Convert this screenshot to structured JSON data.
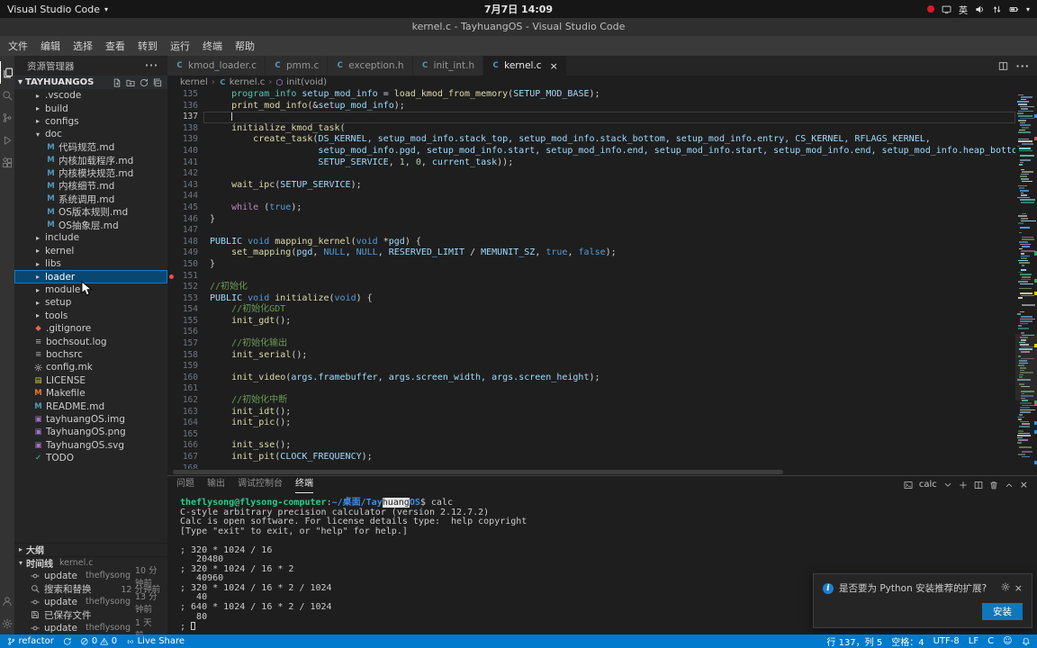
{
  "system_bar": {
    "app_name": "Visual Studio Code",
    "clock": "7月7日 14:09",
    "input_method": "英"
  },
  "title_bar": {
    "title": "kernel.c - TayhuangOS - Visual Studio Code"
  },
  "menu_bar": {
    "items": [
      "文件",
      "编辑",
      "选择",
      "查看",
      "转到",
      "运行",
      "终端",
      "帮助"
    ]
  },
  "activity_bar": {
    "top": [
      {
        "name": "explorer",
        "active": true
      },
      {
        "name": "search"
      },
      {
        "name": "source-control"
      },
      {
        "name": "run-debug"
      },
      {
        "name": "extensions"
      }
    ],
    "bottom": [
      {
        "name": "account"
      },
      {
        "name": "settings"
      }
    ]
  },
  "sidebar": {
    "header": "资源管理器",
    "project": "TAYHUANGOS",
    "tree": [
      {
        "label": ".vscode",
        "kind": "folder",
        "depth": 1
      },
      {
        "label": "build",
        "kind": "folder",
        "depth": 1
      },
      {
        "label": "configs",
        "kind": "folder",
        "depth": 1
      },
      {
        "label": "doc",
        "kind": "folder",
        "depth": 1,
        "expanded": true
      },
      {
        "label": "代码规范.md",
        "kind": "file",
        "icon": "markdown",
        "depth": 2
      },
      {
        "label": "内核加载程序.md",
        "kind": "file",
        "icon": "markdown",
        "depth": 2
      },
      {
        "label": "内核模块规范.md",
        "kind": "file",
        "icon": "markdown",
        "depth": 2
      },
      {
        "label": "内核细节.md",
        "kind": "file",
        "icon": "markdown",
        "depth": 2
      },
      {
        "label": "系统调用.md",
        "kind": "file",
        "icon": "markdown",
        "depth": 2
      },
      {
        "label": "OS版本规则.md",
        "kind": "file",
        "icon": "markdown",
        "depth": 2
      },
      {
        "label": "OS抽象层.md",
        "kind": "file",
        "icon": "markdown",
        "depth": 2
      },
      {
        "label": "include",
        "kind": "folder",
        "depth": 1
      },
      {
        "label": "kernel",
        "kind": "folder",
        "depth": 1
      },
      {
        "label": "libs",
        "kind": "folder",
        "depth": 1
      },
      {
        "label": "loader",
        "kind": "folder",
        "depth": 1,
        "selected": true
      },
      {
        "label": "module",
        "kind": "folder",
        "depth": 1
      },
      {
        "label": "setup",
        "kind": "folder",
        "depth": 1
      },
      {
        "label": "tools",
        "kind": "folder",
        "depth": 1
      },
      {
        "label": ".gitignore",
        "kind": "file",
        "icon": "git",
        "depth": 1
      },
      {
        "label": "bochsout.log",
        "kind": "file",
        "icon": "log",
        "depth": 1
      },
      {
        "label": "bochsrc",
        "kind": "file",
        "icon": "log",
        "depth": 1
      },
      {
        "label": "config.mk",
        "kind": "file",
        "icon": "config",
        "depth": 1
      },
      {
        "label": "LICENSE",
        "kind": "file",
        "icon": "license",
        "depth": 1
      },
      {
        "label": "Makefile",
        "kind": "file",
        "icon": "makefile",
        "depth": 1
      },
      {
        "label": "README.md",
        "kind": "file",
        "icon": "markdown",
        "depth": 1
      },
      {
        "label": "tayhuangOS.img",
        "kind": "file",
        "icon": "image",
        "depth": 1
      },
      {
        "label": "TayhuangOS.png",
        "kind": "file",
        "icon": "image",
        "depth": 1
      },
      {
        "label": "TayhuangOS.svg",
        "kind": "file",
        "icon": "image",
        "depth": 1
      },
      {
        "label": "TODO",
        "kind": "file",
        "icon": "todo",
        "depth": 1
      }
    ],
    "outline_label": "大纲",
    "timeline_label": "时间线",
    "timeline_file": "kernel.c",
    "timeline": [
      {
        "icon": "git-commit",
        "label": "update",
        "author": "theflysong",
        "time": "10 分钟前"
      },
      {
        "icon": "search",
        "label": "搜索和替换",
        "author": "",
        "time": "12 分钟前"
      },
      {
        "icon": "git-commit",
        "label": "update",
        "author": "theflysong",
        "time": "13 分钟前"
      },
      {
        "icon": "save",
        "label": "已保存文件",
        "author": "",
        "time": ""
      },
      {
        "icon": "git-commit",
        "label": "update",
        "author": "theflysong",
        "time": "1 天前"
      }
    ]
  },
  "editor": {
    "tabs": [
      {
        "label": "kmod_loader.c"
      },
      {
        "label": "pmm.c"
      },
      {
        "label": "exception.h"
      },
      {
        "label": "init_int.h"
      },
      {
        "label": "kernel.c",
        "active": true
      }
    ],
    "breadcrumb": [
      {
        "label": "kernel"
      },
      {
        "label": "kernel.c",
        "icon": "c-file"
      },
      {
        "label": "init(void)",
        "icon": "symbol-method"
      }
    ],
    "cursor": {
      "line": 137,
      "col": 5
    },
    "lines": [
      {
        "n": 135,
        "s": [
          [
            "    ",
            ""
          ],
          [
            "program_info",
            "t"
          ],
          [
            " ",
            ""
          ],
          [
            "setup_mod_info",
            "v"
          ],
          [
            " = ",
            ""
          ],
          [
            "load_kmod_from_memory",
            "f"
          ],
          [
            "(",
            ""
          ],
          [
            "SETUP_MOD_BASE",
            "v"
          ],
          [
            ");",
            ""
          ]
        ]
      },
      {
        "n": 136,
        "s": [
          [
            "    ",
            ""
          ],
          [
            "print_mod_info",
            "f"
          ],
          [
            "(&",
            ""
          ],
          [
            "setup_mod_info",
            "v"
          ],
          [
            ");",
            ""
          ]
        ]
      },
      {
        "n": 137,
        "s": [
          [
            "    ",
            ""
          ]
        ],
        "cur": true
      },
      {
        "n": 138,
        "s": [
          [
            "    ",
            ""
          ],
          [
            "initialize_kmod_task",
            "f"
          ],
          [
            "(",
            ""
          ]
        ]
      },
      {
        "n": 139,
        "s": [
          [
            "        ",
            ""
          ],
          [
            "create_task",
            "f"
          ],
          [
            "(",
            ""
          ],
          [
            "DS_KERNEL, setup_mod_info.stack_top, setup_mod_info.stack_bottom, setup_mod_info.entry, CS_KERNEL, RFLAGS_KERNEL,",
            "v"
          ]
        ]
      },
      {
        "n": 140,
        "s": [
          [
            "                    ",
            ""
          ],
          [
            "setup_mod_info.pgd, setup_mod_info.start, setup_mod_info.end, setup_mod_info.start, setup_mod_info.end, setup_mod_info.heap_bottom, setup_mod_info.heap_top,",
            "v"
          ]
        ]
      },
      {
        "n": 141,
        "s": [
          [
            "                    ",
            ""
          ],
          [
            "SETUP_SERVICE",
            "v"
          ],
          [
            ", ",
            ""
          ],
          [
            "1",
            "n"
          ],
          [
            ", ",
            ""
          ],
          [
            "0",
            "n"
          ],
          [
            ", ",
            ""
          ],
          [
            "current_task",
            "v"
          ],
          [
            "));",
            ""
          ]
        ]
      },
      {
        "n": 142,
        "s": []
      },
      {
        "n": 143,
        "s": [
          [
            "    ",
            ""
          ],
          [
            "wait_ipc",
            "f"
          ],
          [
            "(",
            ""
          ],
          [
            "SETUP_SERVICE",
            "v"
          ],
          [
            ");",
            ""
          ]
        ]
      },
      {
        "n": 144,
        "s": []
      },
      {
        "n": 145,
        "s": [
          [
            "    ",
            ""
          ],
          [
            "while",
            "kc"
          ],
          [
            " (",
            ""
          ],
          [
            "true",
            "k"
          ],
          [
            ");",
            ""
          ]
        ]
      },
      {
        "n": 146,
        "s": [
          [
            "}",
            ""
          ]
        ]
      },
      {
        "n": 147,
        "s": []
      },
      {
        "n": 148,
        "s": [
          [
            "PUBLIC",
            "v"
          ],
          [
            " ",
            ""
          ],
          [
            "void",
            "k"
          ],
          [
            " ",
            ""
          ],
          [
            "mapping_kernel",
            "f"
          ],
          [
            "(",
            ""
          ],
          [
            "void",
            "k"
          ],
          [
            " *",
            ""
          ],
          [
            "pgd",
            "v"
          ],
          [
            ") {",
            ""
          ]
        ]
      },
      {
        "n": 149,
        "s": [
          [
            "    ",
            ""
          ],
          [
            "set_mapping",
            "f"
          ],
          [
            "(",
            ""
          ],
          [
            "pgd",
            "v"
          ],
          [
            ", ",
            ""
          ],
          [
            "NULL",
            "k"
          ],
          [
            ", ",
            ""
          ],
          [
            "NULL",
            "k"
          ],
          [
            ", ",
            ""
          ],
          [
            "RESERVED_LIMIT",
            "v"
          ],
          [
            " / ",
            ""
          ],
          [
            "MEMUNIT_SZ",
            "v"
          ],
          [
            ", ",
            ""
          ],
          [
            "true",
            "k"
          ],
          [
            ", ",
            ""
          ],
          [
            "false",
            "k"
          ],
          [
            ");",
            ""
          ]
        ]
      },
      {
        "n": 150,
        "s": [
          [
            "}",
            ""
          ]
        ]
      },
      {
        "n": 151,
        "s": [],
        "gm": true
      },
      {
        "n": 152,
        "s": [
          [
            "//初始化",
            "c"
          ]
        ]
      },
      {
        "n": 153,
        "s": [
          [
            "PUBLIC",
            "v"
          ],
          [
            " ",
            ""
          ],
          [
            "void",
            "k"
          ],
          [
            " ",
            ""
          ],
          [
            "initialize",
            "f"
          ],
          [
            "(",
            ""
          ],
          [
            "void",
            "k"
          ],
          [
            ") {",
            ""
          ]
        ]
      },
      {
        "n": 154,
        "s": [
          [
            "    //初始化GDT",
            "c"
          ]
        ]
      },
      {
        "n": 155,
        "s": [
          [
            "    ",
            ""
          ],
          [
            "init_gdt",
            "f"
          ],
          [
            "();",
            ""
          ]
        ]
      },
      {
        "n": 156,
        "s": []
      },
      {
        "n": 157,
        "s": [
          [
            "    //初始化输出",
            "c"
          ]
        ]
      },
      {
        "n": 158,
        "s": [
          [
            "    ",
            ""
          ],
          [
            "init_serial",
            "f"
          ],
          [
            "();",
            ""
          ]
        ]
      },
      {
        "n": 159,
        "s": []
      },
      {
        "n": 160,
        "s": [
          [
            "    ",
            ""
          ],
          [
            "init_video",
            "f"
          ],
          [
            "(",
            ""
          ],
          [
            "args.framebuffer, args.screen_width, args.screen_height",
            "v"
          ],
          [
            ");",
            ""
          ]
        ]
      },
      {
        "n": 161,
        "s": []
      },
      {
        "n": 162,
        "s": [
          [
            "    //初始化中断",
            "c"
          ]
        ]
      },
      {
        "n": 163,
        "s": [
          [
            "    ",
            ""
          ],
          [
            "init_idt",
            "f"
          ],
          [
            "();",
            ""
          ]
        ]
      },
      {
        "n": 164,
        "s": [
          [
            "    ",
            ""
          ],
          [
            "init_pic",
            "f"
          ],
          [
            "();",
            ""
          ]
        ]
      },
      {
        "n": 165,
        "s": []
      },
      {
        "n": 166,
        "s": [
          [
            "    ",
            ""
          ],
          [
            "init_sse",
            "f"
          ],
          [
            "();",
            ""
          ]
        ]
      },
      {
        "n": 167,
        "s": [
          [
            "    ",
            ""
          ],
          [
            "init_pit",
            "f"
          ],
          [
            "(",
            ""
          ],
          [
            "CLOCK_FREQUENCY",
            "v"
          ],
          [
            ");",
            ""
          ]
        ]
      },
      {
        "n": 168,
        "s": []
      }
    ]
  },
  "panel": {
    "tabs": [
      {
        "label": "问题"
      },
      {
        "label": "输出"
      },
      {
        "label": "调试控制台"
      },
      {
        "label": "终端",
        "active": true
      }
    ],
    "terminal_name": "calc",
    "terminal_lines": [
      {
        "s": [
          [
            "theflysong@flysong-computer",
            "g"
          ],
          [
            ":",
            ""
          ],
          [
            "~/桌面/Tay",
            "b"
          ],
          [
            "huang",
            "sel"
          ],
          [
            "OS",
            "b"
          ],
          [
            "$ calc",
            ""
          ]
        ]
      },
      {
        "s": [
          [
            "C-style arbitrary precision calculator (version 2.12.7.2)",
            ""
          ]
        ]
      },
      {
        "s": [
          [
            "Calc is open software. For license details type:  help copyright",
            ""
          ]
        ]
      },
      {
        "s": [
          [
            "[Type \"exit\" to exit, or \"help\" for help.]",
            ""
          ]
        ]
      },
      {
        "s": []
      },
      {
        "s": [
          [
            "; 320 * 1024 / 16",
            ""
          ]
        ]
      },
      {
        "s": [
          [
            "   20480",
            ""
          ]
        ]
      },
      {
        "s": [
          [
            "; 320 * 1024 / 16 * 2",
            ""
          ]
        ]
      },
      {
        "s": [
          [
            "   40960",
            ""
          ]
        ]
      },
      {
        "s": [
          [
            "; 320 * 1024 / 16 * 2 / 1024",
            ""
          ]
        ]
      },
      {
        "s": [
          [
            "   40",
            ""
          ]
        ]
      },
      {
        "s": [
          [
            "; 640 * 1024 / 16 * 2 / 1024",
            ""
          ]
        ]
      },
      {
        "s": [
          [
            "   80",
            ""
          ]
        ]
      },
      {
        "s": [
          [
            "; ",
            ""
          ]
        ],
        "cursor": true
      }
    ]
  },
  "notification": {
    "message": "是否要为 Python 安装推荐的扩展?",
    "install_label": "安装"
  },
  "status_bar": {
    "branch": "refactor",
    "errors": "0",
    "warnings": "0",
    "live_share": "Live Share",
    "line_col": "行 137，列 5",
    "spaces": "空格：4",
    "encoding": "UTF-8",
    "eol": "LF",
    "language": "C"
  },
  "colors": {
    "status_bar": "#007acc",
    "list_selection": "#094771",
    "install_button": "#1177bb",
    "terminal_green": "#23d18b",
    "terminal_blue": "#3b8eea"
  }
}
